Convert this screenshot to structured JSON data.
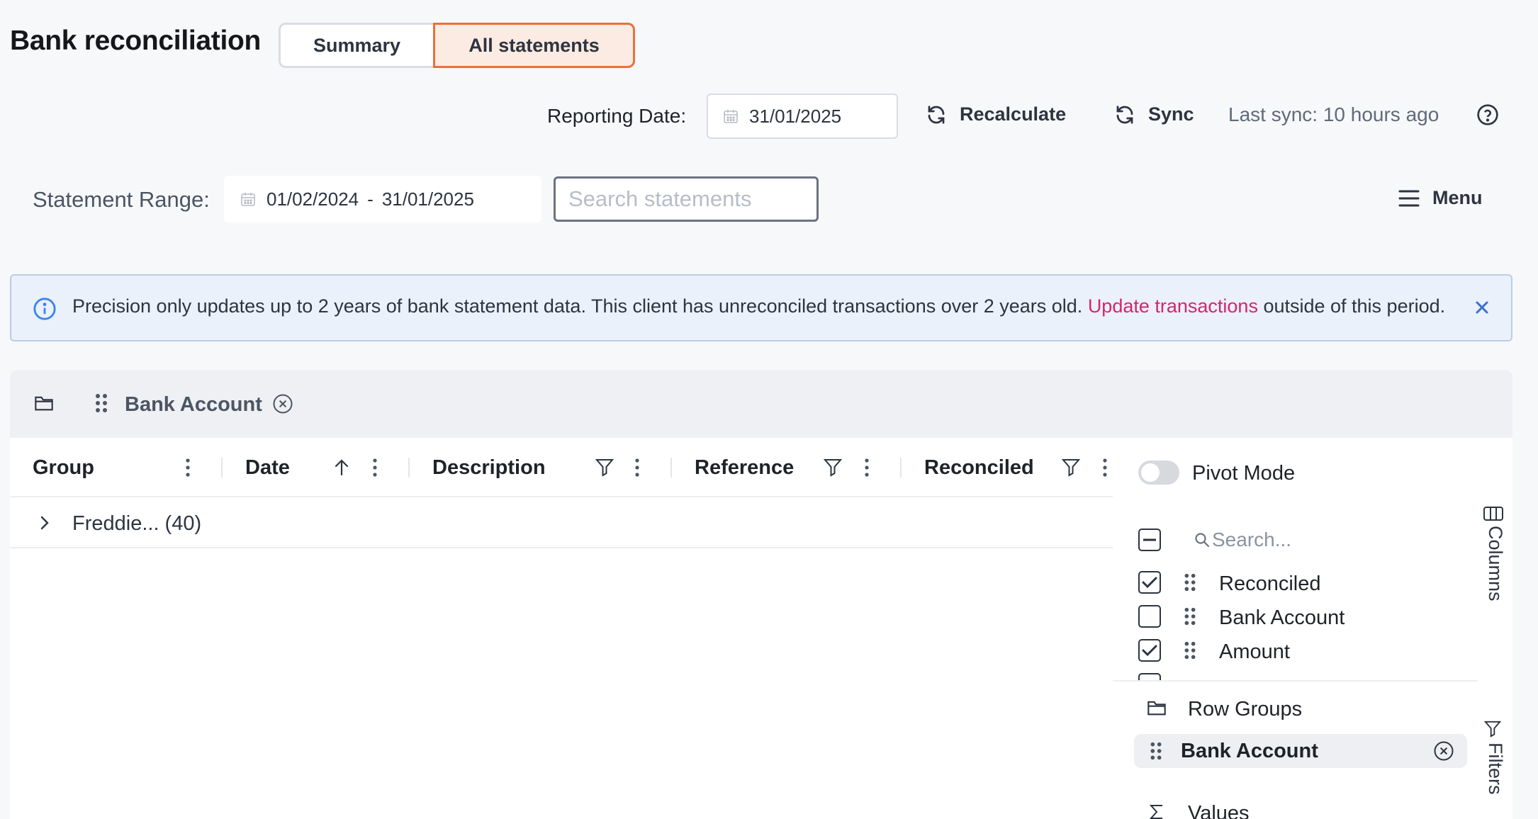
{
  "header": {
    "title": "Bank reconciliation",
    "tabs": [
      {
        "label": "Summary",
        "active": false
      },
      {
        "label": "All statements",
        "active": true
      }
    ]
  },
  "reporting": {
    "label": "Reporting Date:",
    "date": "31/01/2025",
    "recalculate_label": "Recalculate",
    "sync_label": "Sync",
    "last_sync": "Last sync: 10 hours ago"
  },
  "statement": {
    "range_label": "Statement Range:",
    "range_start": "01/02/2024",
    "range_sep": "-",
    "range_end": "31/01/2025",
    "search_placeholder": "Search statements",
    "menu_label": "Menu"
  },
  "banner": {
    "text_before": "Precision only updates up to 2 years of bank statement data. This client has unreconciled transactions over 2 years old. ",
    "link": "Update transactions",
    "text_after": " outside of this period."
  },
  "grid": {
    "group_bar": {
      "label": "Bank Account"
    },
    "columns": [
      "Group",
      "Date",
      "Description",
      "Reference",
      "Reconciled"
    ],
    "rows": [
      {
        "label": "Freddie... (40)"
      }
    ]
  },
  "side_panel": {
    "pivot_label": "Pivot Mode",
    "search_placeholder": "Search...",
    "column_items": [
      {
        "label": "Reconciled",
        "checked": true
      },
      {
        "label": "Bank Account",
        "checked": false
      },
      {
        "label": "Amount",
        "checked": true
      }
    ],
    "row_groups_label": "Row Groups",
    "row_group_chip": "Bank Account",
    "values_label": "Values",
    "tab_columns": "Columns",
    "tab_filters": "Filters"
  },
  "colors": {
    "accent": "#e8713c",
    "link": "#d6246e",
    "banner_bg": "#eaf1fb",
    "info_blue": "#3b82f6"
  }
}
